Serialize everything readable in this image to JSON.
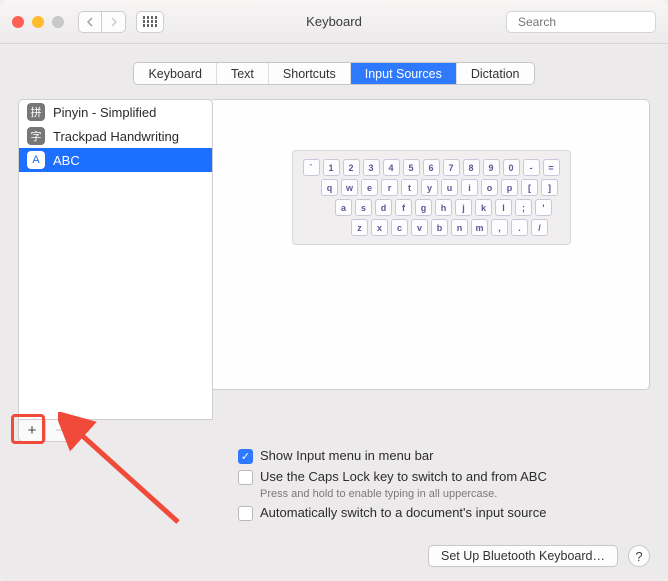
{
  "window": {
    "title": "Keyboard",
    "search_placeholder": "Search"
  },
  "tabs": [
    {
      "label": "Keyboard",
      "active": false
    },
    {
      "label": "Text",
      "active": false
    },
    {
      "label": "Shortcuts",
      "active": false
    },
    {
      "label": "Input Sources",
      "active": true
    },
    {
      "label": "Dictation",
      "active": false
    }
  ],
  "sources": [
    {
      "badge": "拼",
      "label": "Pinyin - Simplified",
      "selected": false
    },
    {
      "badge": "字",
      "label": "Trackpad Handwriting",
      "selected": false
    },
    {
      "badge": "A",
      "label": "ABC",
      "selected": true
    }
  ],
  "keyboard_rows": [
    [
      "`",
      "1",
      "2",
      "3",
      "4",
      "5",
      "6",
      "7",
      "8",
      "9",
      "0",
      "-",
      "="
    ],
    [
      "q",
      "w",
      "e",
      "r",
      "t",
      "y",
      "u",
      "i",
      "o",
      "p",
      "[",
      "]"
    ],
    [
      "a",
      "s",
      "d",
      "f",
      "g",
      "h",
      "j",
      "k",
      "l",
      ";",
      "'"
    ],
    [
      "z",
      "x",
      "c",
      "v",
      "b",
      "n",
      "m",
      ",",
      ".",
      "/"
    ]
  ],
  "options": {
    "show_menu": {
      "checked": true,
      "label": "Show Input menu in menu bar"
    },
    "caps_lock": {
      "checked": false,
      "label": "Use the Caps Lock key to switch to and from ABC",
      "sub": "Press and hold to enable typing in all uppercase."
    },
    "auto_switch": {
      "checked": false,
      "label": "Automatically switch to a document's input source"
    }
  },
  "footer": {
    "bluetooth": "Set Up Bluetooth Keyboard…",
    "help": "?"
  },
  "add_glyph": "+",
  "remove_glyph": "−"
}
